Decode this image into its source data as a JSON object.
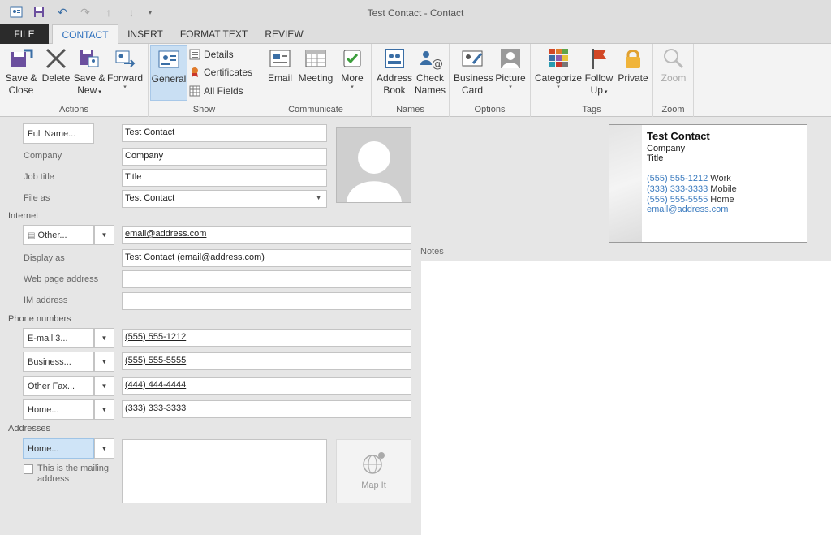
{
  "window": {
    "title": "Test Contact - Contact"
  },
  "tabs": [
    {
      "label": "FILE"
    },
    {
      "label": "CONTACT"
    },
    {
      "label": "INSERT"
    },
    {
      "label": "FORMAT TEXT"
    },
    {
      "label": "REVIEW"
    }
  ],
  "ribbon": {
    "actions": {
      "label": "Actions",
      "save_close": [
        "Save &",
        "Close"
      ],
      "delete": "Delete",
      "save_new": [
        "Save &",
        "New"
      ],
      "forward": "Forward"
    },
    "show": {
      "label": "Show",
      "general": "General",
      "details": "Details",
      "certificates": "Certificates",
      "all_fields": "All Fields"
    },
    "communicate": {
      "label": "Communicate",
      "email": "Email",
      "meeting": "Meeting",
      "more": "More"
    },
    "names": {
      "label": "Names",
      "address_book": [
        "Address",
        "Book"
      ],
      "check_names": [
        "Check",
        "Names"
      ]
    },
    "options": {
      "label": "Options",
      "business_card": [
        "Business",
        "Card"
      ],
      "picture": "Picture"
    },
    "tags": {
      "label": "Tags",
      "categorize": "Categorize",
      "follow_up": [
        "Follow",
        "Up"
      ],
      "private": "Private"
    },
    "zoom": {
      "label": "Zoom",
      "zoom": "Zoom"
    }
  },
  "form": {
    "full_name_button": "Full Name...",
    "full_name": "Test Contact",
    "company_label": "Company",
    "company": "Company",
    "job_title_label": "Job title",
    "job_title": "Title",
    "file_as_label": "File as",
    "file_as": "Test Contact",
    "internet_section": "Internet",
    "email_type": "Other...",
    "email": "email@address.com",
    "display_as_label": "Display as",
    "display_as": "Test Contact (email@address.com)",
    "web_page_label": "Web page address",
    "web_page": "",
    "im_label": "IM address",
    "im": "",
    "phone_section": "Phone numbers",
    "phones": [
      {
        "type": "E-mail 3...",
        "value": "(555) 555-1212"
      },
      {
        "type": "Business...",
        "value": "(555) 555-5555"
      },
      {
        "type": "Other Fax...",
        "value": "(444) 444-4444"
      },
      {
        "type": "Home...",
        "value": "(333) 333-3333"
      }
    ],
    "addresses_section": "Addresses",
    "address_type": "Home...",
    "address": "",
    "mailing_checkbox": "This is the mailing address",
    "map_it": "Map It"
  },
  "notes": {
    "label": "Notes"
  },
  "business_card": {
    "name": "Test Contact",
    "company": "Company",
    "title": "Title",
    "phones": [
      {
        "number": "(555) 555-1212",
        "type": "Work"
      },
      {
        "number": "(333) 333-3333",
        "type": "Mobile"
      },
      {
        "number": "(555) 555-5555",
        "type": "Home"
      }
    ],
    "email": "email@address.com"
  }
}
